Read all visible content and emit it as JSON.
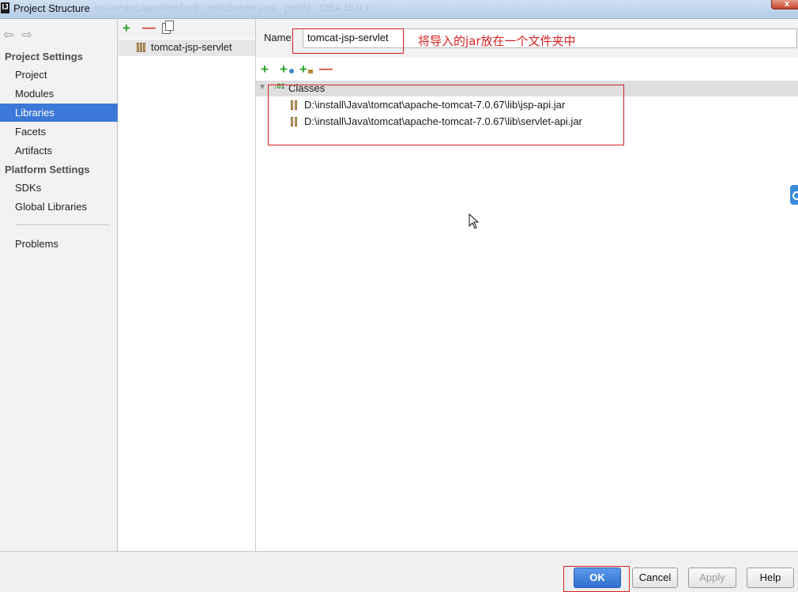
{
  "window": {
    "title": "Project Structure",
    "background_title": "no-servingJavaWebTest] - helloServlet.java - [test5] - IDEA 15.0.x",
    "close_glyph": "x"
  },
  "nav": {
    "back_icon": "arrow-left-icon",
    "forward_icon": "arrow-right-icon",
    "project_settings_header": "Project Settings",
    "project_settings_items": [
      "Project",
      "Modules",
      "Libraries",
      "Facets",
      "Artifacts"
    ],
    "platform_settings_header": "Platform Settings",
    "platform_settings_items": [
      "SDKs",
      "Global Libraries"
    ],
    "problems": "Problems",
    "selected": "Libraries",
    "selected_color": "#3c78d8"
  },
  "library_list": {
    "items": [
      "tomcat-jsp-servlet"
    ]
  },
  "library_detail": {
    "name_label": "Name",
    "name_value": "tomcat-jsp-servlet",
    "annotation": "将导入的jar放在一个文件夹中",
    "annotation_color": "#d62020",
    "classes_header": "Classes",
    "jars": [
      "D:\\install\\Java\\tomcat\\apache-tomcat-7.0.67\\lib\\jsp-api.jar",
      "D:\\install\\Java\\tomcat\\apache-tomcat-7.0.67\\lib\\servlet-api.jar"
    ]
  },
  "buttons": {
    "ok": "OK",
    "cancel": "Cancel",
    "apply": "Apply",
    "help": "Help"
  }
}
